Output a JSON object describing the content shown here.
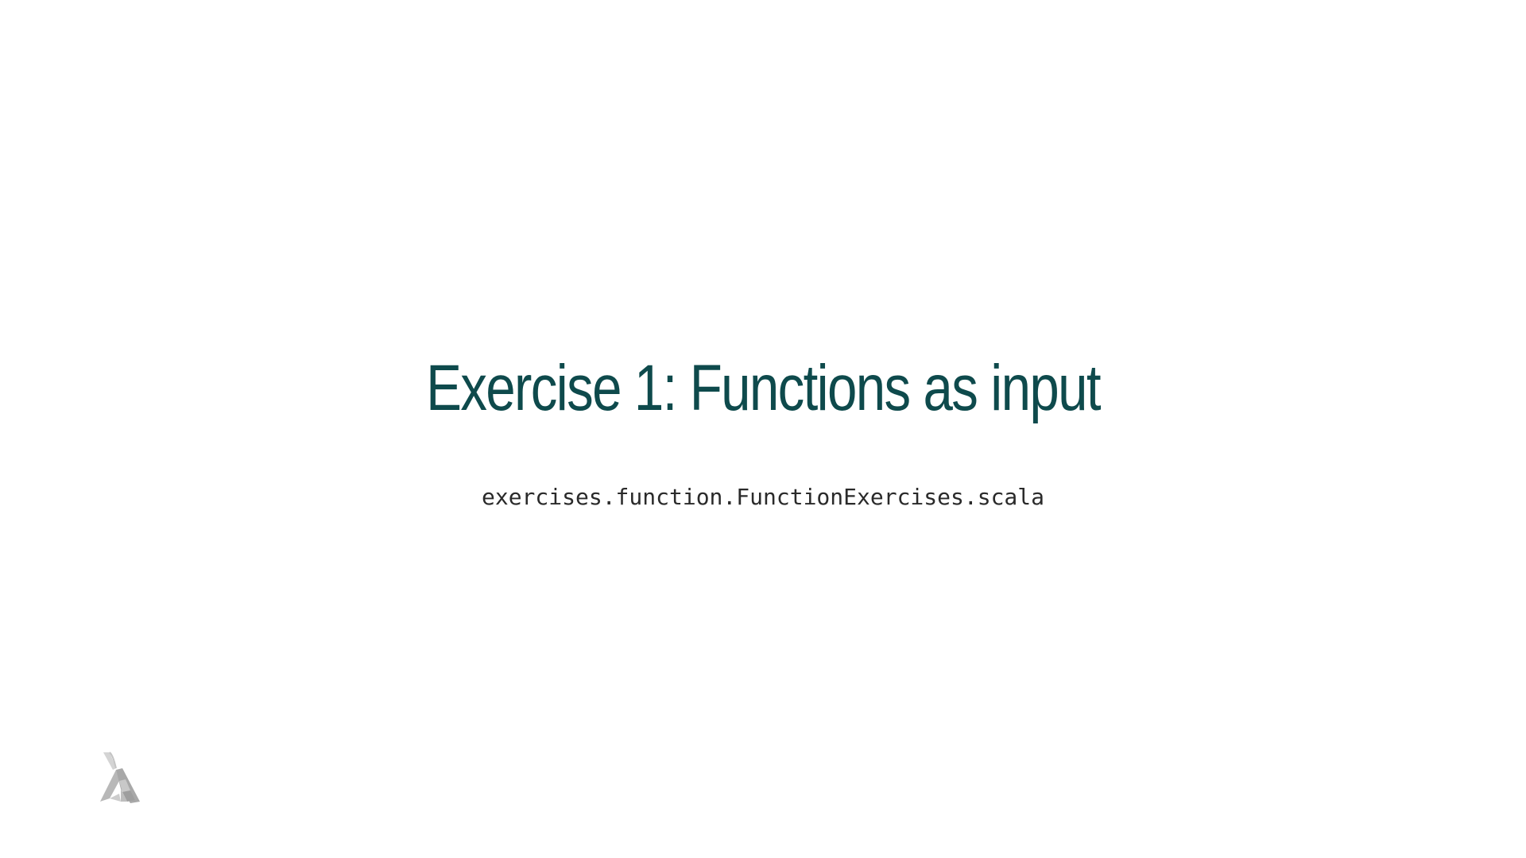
{
  "slide": {
    "title": "Exercise 1: Functions as input",
    "subtitle": "exercises.function.FunctionExercises.scala"
  },
  "colors": {
    "title": "#0e4a4c",
    "subtitle": "#2a2a2a",
    "logo": "#b0b0b0",
    "background": "#ffffff"
  },
  "icons": {
    "logo": "lambda-logo-icon"
  }
}
